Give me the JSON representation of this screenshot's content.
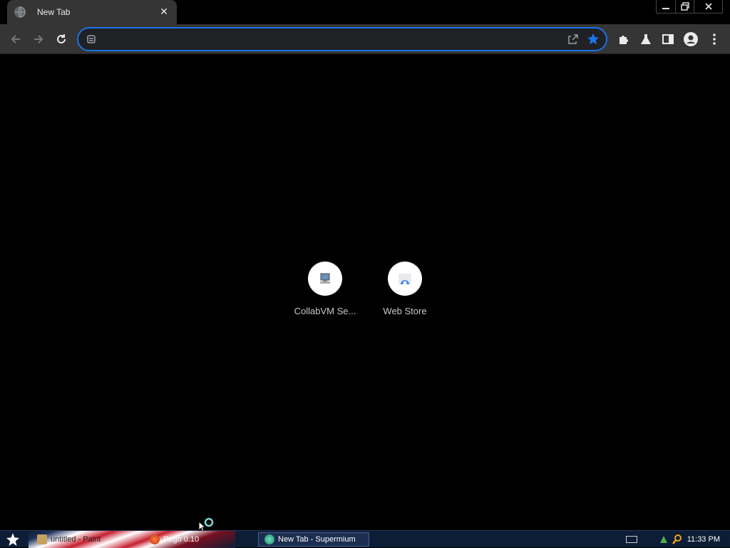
{
  "browser": {
    "tab": {
      "title": "New Tab",
      "close_glyph": "✕",
      "favicon": "globe-icon"
    },
    "window_controls": {
      "minimize": "minimize-icon",
      "restore": "restore-icon",
      "close": "close-icon"
    },
    "omnibox": {
      "value": "",
      "placeholder": ""
    },
    "accent_color": "#1a73e8",
    "toolbar_icons": [
      "back-icon",
      "forward-icon",
      "reload-icon",
      "share-icon",
      "bookmark-star-icon",
      "extensions-icon",
      "labs-flask-icon",
      "side-panel-icon",
      "profile-icon",
      "menu-icon"
    ]
  },
  "shortcuts": [
    {
      "label": "CollabVM Se...",
      "icon": "collabvm-icon"
    },
    {
      "label": "Web Store",
      "icon": "web-store-icon"
    }
  ],
  "taskbar": {
    "start_icon": "star-icon",
    "items": [
      {
        "label": "untitled - Paint",
        "icon": "paint-icon"
      },
      {
        "label": "Pego 0.10",
        "icon": "pego-icon"
      },
      {
        "label": "New Tab - Supermium",
        "icon": "supermium-icon"
      }
    ],
    "clock": "11:33 PM"
  }
}
